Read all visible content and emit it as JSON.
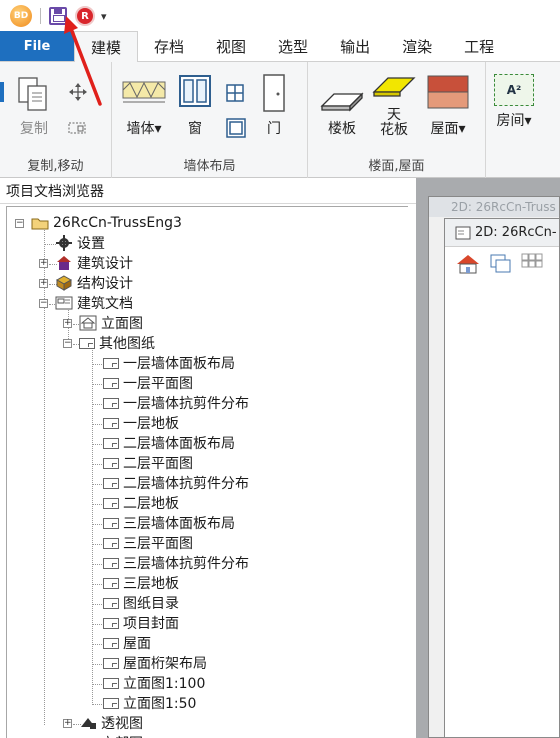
{
  "quick_access": {
    "logo_text": "BD",
    "r_button_text": "R",
    "dropdown_glyph": "▾"
  },
  "tabs": {
    "file": "File",
    "items": [
      "建模",
      "存档",
      "视图",
      "选型",
      "输出",
      "渲染",
      "工程"
    ],
    "active": "建模"
  },
  "ribbon": {
    "copy": "复制",
    "wall": "墙体",
    "window": "窗",
    "door": "门",
    "floor_slab": "楼板",
    "ceiling_line1": "天",
    "ceiling_line2": "花板",
    "roof": "屋面",
    "room": "房间",
    "room_icon_text": "A²",
    "groups": {
      "copy_move": "复制,移动",
      "wall_layout": "墙体布局",
      "floor_roof": "楼面,屋面"
    }
  },
  "browser": {
    "title": "项目文档浏览器",
    "root": "26RcCn-TrussEng3",
    "settings": "设置",
    "arch_design": "建筑设计",
    "struct_design": "结构设计",
    "arch_docs": "建筑文档",
    "elevation": "立面图",
    "other_drawings": "其他图纸",
    "drawings": [
      "一层墙体面板布局",
      "一层平面图",
      "一层墙体抗剪件分布",
      "一层地板",
      "二层墙体面板布局",
      "二层平面图",
      "二层墙体抗剪件分布",
      "二层地板",
      "三层墙体面板布局",
      "三层平面图",
      "三层墙体抗剪件分布",
      "三层地板",
      "图纸目录",
      "项目封面",
      "屋面",
      "屋面桁架布局",
      "立面图1:100",
      "立面图1:50"
    ],
    "perspective": "透视图",
    "last_partial": "立部图"
  },
  "windows": {
    "back_title": "2D: 26RcCn-Truss",
    "front_title": "2D: 26RcCn-"
  },
  "colors": {
    "file_tab": "#1e6fbf",
    "arrow": "#e0201b",
    "roof": "#c8503a",
    "ceiling": "#f2e600"
  }
}
